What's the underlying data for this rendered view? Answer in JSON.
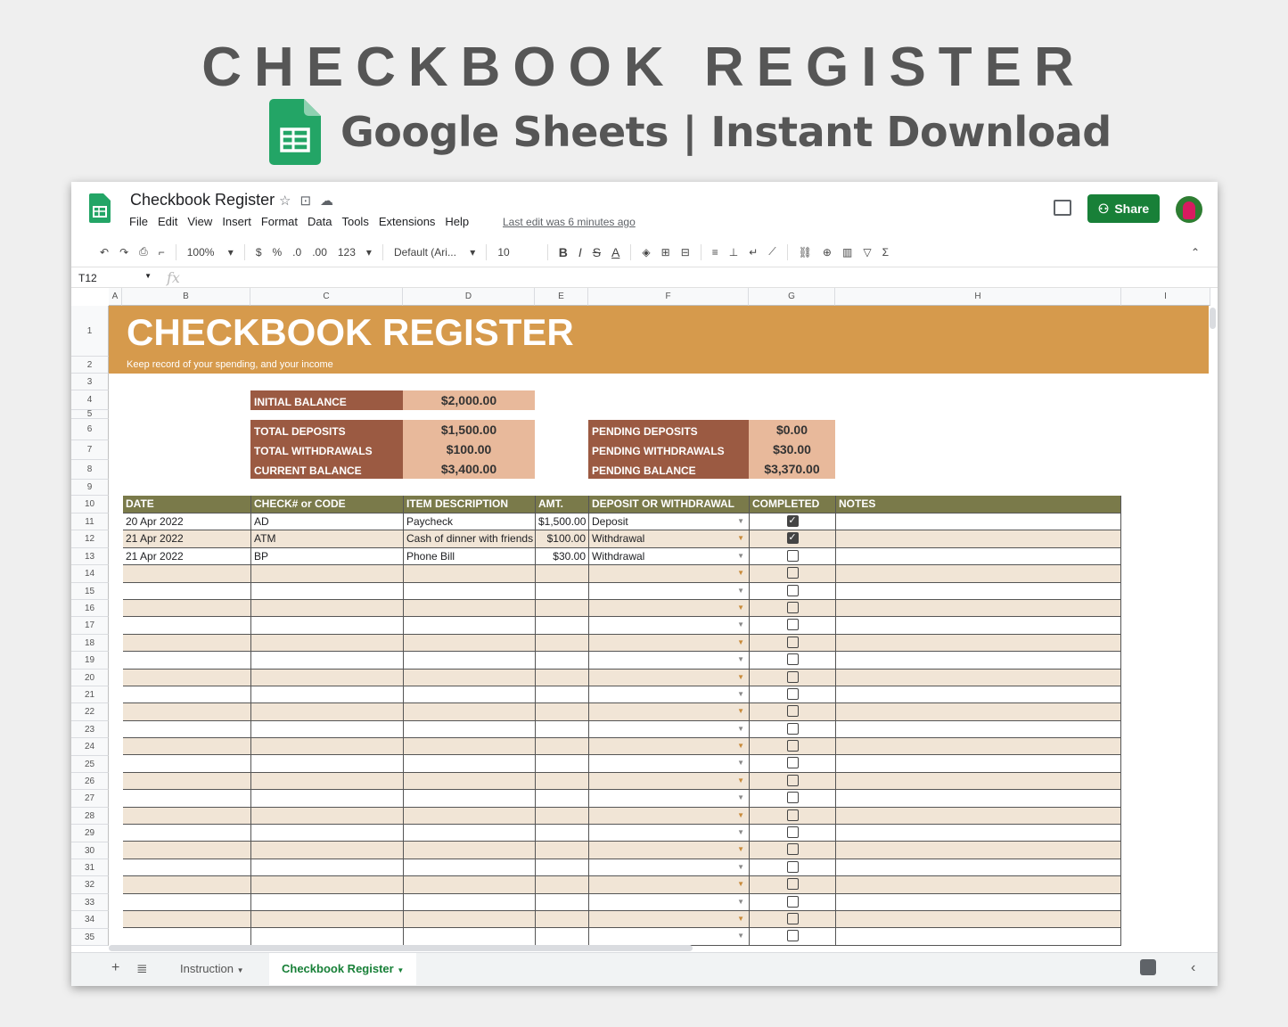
{
  "ad": {
    "title": "CHECKBOOK REGISTER",
    "subtitle": "Google Sheets | Instant Download"
  },
  "app": {
    "doc_title": "Checkbook Register",
    "menu": [
      "File",
      "Edit",
      "View",
      "Insert",
      "Format",
      "Data",
      "Tools",
      "Extensions",
      "Help"
    ],
    "last_edit": "Last edit was 6 minutes ago",
    "share_label": "Share",
    "toolbar": {
      "zoom": "100%",
      "currency": "$",
      "percent": "%",
      "dec_less": ".0",
      "dec_more": ".00",
      "more_formats": "123",
      "font": "Default (Ari...",
      "font_size": "10",
      "bold": "B",
      "italic": "I",
      "strike": "S",
      "text_color": "A"
    },
    "name_box": "T12",
    "fx": "fx"
  },
  "columns": [
    "A",
    "B",
    "C",
    "D",
    "E",
    "F",
    "G",
    "H",
    "I"
  ],
  "rows": [
    "1",
    "2",
    "3",
    "4",
    "5",
    "6",
    "7",
    "8",
    "9",
    "10",
    "11",
    "12",
    "13",
    "14",
    "15",
    "16",
    "17",
    "18",
    "19",
    "20",
    "21",
    "22",
    "23",
    "24",
    "25",
    "26",
    "27",
    "28",
    "29",
    "30",
    "31",
    "32",
    "33",
    "34",
    "35"
  ],
  "sheet": {
    "title": "CHECKBOOK REGISTER",
    "subtitle": "Keep record of your spending, and your income",
    "initial_label": "INITIAL BALANCE",
    "initial_value": "$2,000.00",
    "summary_left": [
      {
        "label": "TOTAL DEPOSITS",
        "value": "$1,500.00"
      },
      {
        "label": "TOTAL WITHDRAWALS",
        "value": "$100.00"
      },
      {
        "label": "CURRENT BALANCE",
        "value": "$3,400.00"
      }
    ],
    "summary_right": [
      {
        "label": "PENDING DEPOSITS",
        "value": "$0.00"
      },
      {
        "label": "PENDING WITHDRAWALS",
        "value": "$30.00"
      },
      {
        "label": "PENDING BALANCE",
        "value": "$3,370.00"
      }
    ],
    "headers": [
      "DATE",
      "CHECK# or CODE",
      "ITEM DESCRIPTION",
      "AMT.",
      "DEPOSIT OR WITHDRAWAL",
      "COMPLETED",
      "NOTES"
    ],
    "entries": [
      {
        "date": "20 Apr 2022",
        "code": "AD",
        "desc": "Paycheck",
        "amt": "$1,500.00",
        "type": "Deposit",
        "done": true,
        "notes": ""
      },
      {
        "date": "21 Apr 2022",
        "code": "ATM",
        "desc": "Cash of dinner with friends",
        "amt": "$100.00",
        "type": "Withdrawal",
        "done": true,
        "notes": ""
      },
      {
        "date": "21 Apr 2022",
        "code": "BP",
        "desc": "Phone Bill",
        "amt": "$30.00",
        "type": "Withdrawal",
        "done": false,
        "notes": ""
      }
    ],
    "empty_rows": 22
  },
  "tabs": [
    "Instruction",
    "Checkbook Register"
  ],
  "active_tab": "Checkbook Register",
  "colors": {
    "banner": "#d69a4c",
    "label": "#9b5a42",
    "value": "#e8b99b",
    "header": "#7a7a4a",
    "alt_row": "#f1e5d6",
    "share": "#188038"
  }
}
